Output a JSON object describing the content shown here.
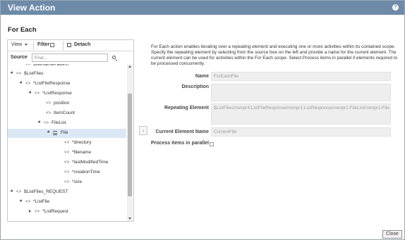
{
  "window": {
    "title": "View Action",
    "help_icon": "question-icon"
  },
  "section_title": "For Each",
  "toolbar": {
    "view_label": "View",
    "filter_label": "Filter",
    "detach_label": "Detach"
  },
  "source": {
    "label": "Source",
    "placeholder": "Find..."
  },
  "tree": {
    "items": [
      {
        "label": "$fileNamePattern",
        "toggle": "none",
        "icon": "element"
      },
      {
        "label": "$ListFiles",
        "toggle": "expanded",
        "icon": "element"
      },
      {
        "label": "*ListFileResponse",
        "toggle": "expanded",
        "icon": "element"
      },
      {
        "label": "*ListResponse",
        "toggle": "expanded",
        "icon": "element"
      },
      {
        "label": "position",
        "toggle": "none",
        "icon": "element"
      },
      {
        "label": "ItemCount",
        "toggle": "none",
        "icon": "element"
      },
      {
        "label": "FileList",
        "toggle": "expanded",
        "icon": "element"
      },
      {
        "label": "File",
        "toggle": "expanded",
        "icon": "repeating-list",
        "selected": true
      },
      {
        "label": "*directory",
        "toggle": "none",
        "icon": "element"
      },
      {
        "label": "*filename",
        "toggle": "none",
        "icon": "element"
      },
      {
        "label": "*lastModifiedTime",
        "toggle": "none",
        "icon": "element"
      },
      {
        "label": "*creationTime",
        "toggle": "none",
        "icon": "element"
      },
      {
        "label": "*size",
        "toggle": "none",
        "icon": "element"
      },
      {
        "label": "$ListFiles_REQUEST",
        "toggle": "expanded",
        "icon": "element"
      },
      {
        "label": "*ListFile",
        "toggle": "expanded",
        "icon": "element"
      },
      {
        "label": "*ListRequest",
        "toggle": "collapsed",
        "icon": "element"
      }
    ]
  },
  "description": "For Each action enables iterating over a repeating element and executing one or more activities within its contained scope. Specify the repeating element by selecting from the source tree on the left and provide a name for the current element. The current element can be used for activities within the For Each scope. Select Process items in parallel if elements required to be processed concurrently.",
  "properties": {
    "name_label": "Name",
    "name_value": "ForEachFile",
    "description_label": "Description",
    "description_value": "",
    "repeating_label": "Repeating Element",
    "repeating_value": "$ListFiles/nsmpr4:ListFileResponse/nsmpr1:ListResponse/nsmpr1:FileList/nsmpr1:File",
    "current_label": "Current Element Name",
    "current_value": "CurrentFile",
    "parallel_label": "Process items in parallel",
    "parallel_checked": false
  },
  "footer": {
    "close_label": "Close"
  },
  "colors": {
    "titlebar": "#6d8aa8",
    "selected_row": "#dce8f5",
    "field_bg": "#eeeeee"
  }
}
